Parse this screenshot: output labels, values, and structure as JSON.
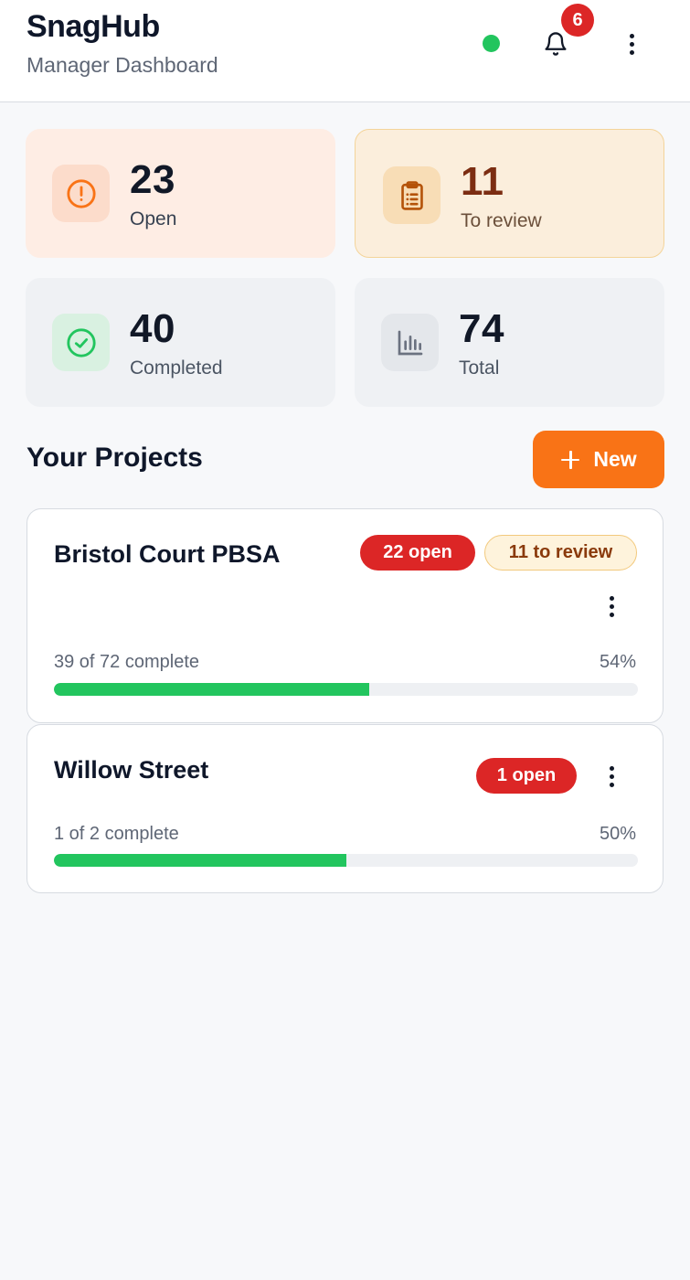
{
  "app": {
    "title": "SnagHub",
    "subtitle": "Manager Dashboard",
    "status_color": "#22C55E",
    "notification_count": "6",
    "notification_color": "#DC2626"
  },
  "stats": [
    {
      "value": "23",
      "label": "Open",
      "icon": "alert-circle-icon",
      "bg": "#FEEDE4",
      "border": "#FEEDE4",
      "icon_bg": "#FCDCCB",
      "icon_color": "#F97316",
      "value_color": "#111827",
      "label_color": "#374151"
    },
    {
      "value": "11",
      "label": "To review",
      "icon": "clipboard-icon",
      "bg": "#FBEEDC",
      "border": "#F4D49A",
      "icon_bg": "#F8DDB6",
      "icon_color": "#B45309",
      "value_color": "#7C2D12",
      "label_color": "#6B4F3A"
    },
    {
      "value": "40",
      "label": "Completed",
      "icon": "check-circle-icon",
      "bg": "#EFF1F4",
      "border": "#EFF1F4",
      "icon_bg": "#D9F1E1",
      "icon_color": "#22C55E",
      "value_color": "#111827",
      "label_color": "#4B5563"
    },
    {
      "value": "74",
      "label": "Total",
      "icon": "bar-chart-icon",
      "bg": "#EFF1F4",
      "border": "#EFF1F4",
      "icon_bg": "#E4E7EB",
      "icon_color": "#6B7280",
      "value_color": "#111827",
      "label_color": "#4B5563"
    }
  ],
  "projects_section": {
    "title": "Your Projects",
    "new_label": "New",
    "accent": "#F97316"
  },
  "projects": [
    {
      "name": "Bristol Court PBSA",
      "open_badge": "22 open",
      "review_badge": "11 to review",
      "progress_text": "39 of 72 complete",
      "percent_label": "54%",
      "progress": 0.54
    },
    {
      "name": "Willow Street",
      "open_badge": "1 open",
      "progress_text": "1 of 2 complete",
      "percent_label": "50%",
      "progress": 0.5
    }
  ],
  "colors": {
    "open_badge_bg": "#DC2626",
    "review_badge_bg": "#FEF3DC",
    "review_badge_border": "#F2C97D",
    "review_badge_text": "#8A3A0C",
    "progress_fill": "#22C55E"
  }
}
